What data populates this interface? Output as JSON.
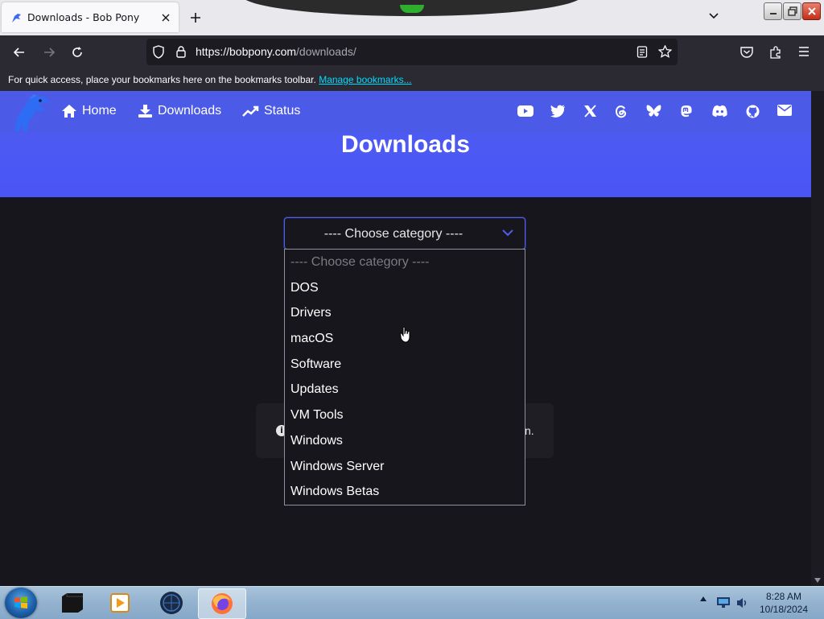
{
  "browser": {
    "tab": {
      "title": "Downloads - Bob Pony"
    },
    "url": {
      "domain": "https://bobpony.com",
      "path": "/downloads/"
    },
    "bookmarks_bar": {
      "message": "For quick access, place your bookmarks here on the bookmarks toolbar.",
      "link": "Manage bookmarks..."
    }
  },
  "site": {
    "nav": [
      {
        "label": "Home",
        "icon": "home-icon"
      },
      {
        "label": "Downloads",
        "icon": "download-icon"
      },
      {
        "label": "Status",
        "icon": "trend-icon"
      }
    ],
    "social_icons": [
      "youtube-icon",
      "twitter-icon",
      "x-icon",
      "threads-icon",
      "bluesky-icon",
      "mastodon-icon",
      "discord-icon",
      "github-icon",
      "mail-icon"
    ],
    "page_title": "Downloads",
    "category_select": {
      "selected": "---- Choose category ----",
      "options": [
        "---- Choose category ----",
        "DOS",
        "Drivers",
        "macOS",
        "Software",
        "Updates",
        "VM Tools",
        "Windows",
        "Windows Server",
        "Windows Betas"
      ]
    },
    "info_card_tail": "n."
  },
  "taskbar": {
    "apps": [
      "terminal-app",
      "media-player-app",
      "globe-app",
      "firefox-app"
    ],
    "clock": {
      "time": "8:28 AM",
      "date": "10/18/2024"
    }
  },
  "colors": {
    "accent": "#4f5ef0",
    "page_bg": "#17161c"
  }
}
